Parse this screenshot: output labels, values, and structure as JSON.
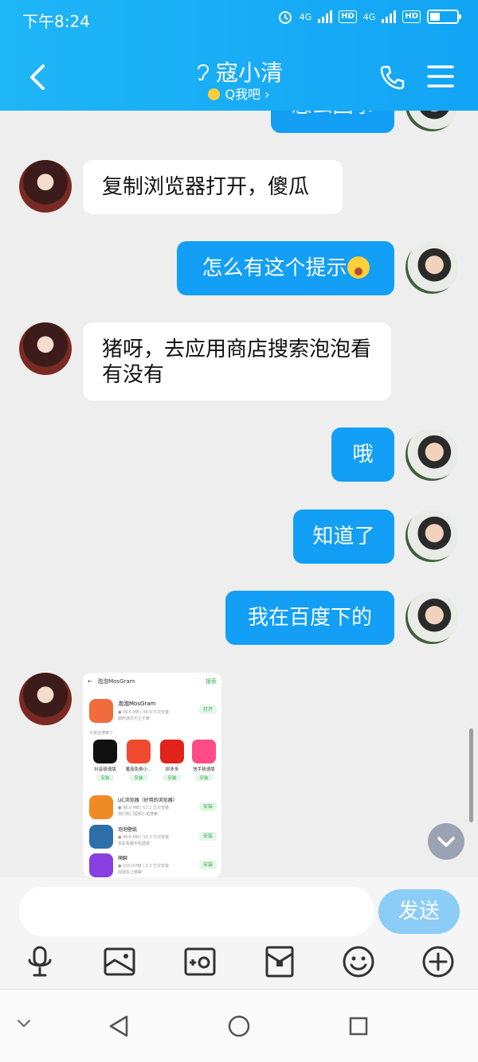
{
  "status_bar": {
    "time": "下午8:24",
    "net1": "4G",
    "hd1": "HD",
    "net2": "4G",
    "hd2": "HD"
  },
  "header": {
    "title": "寇小清",
    "subtitle": "Q我吧 ›"
  },
  "messages": [
    {
      "side": "right",
      "text": "怎么回事"
    },
    {
      "side": "left",
      "text": "复制浏览器打开，傻瓜"
    },
    {
      "side": "right",
      "text": "怎么有这个提示"
    },
    {
      "side": "left",
      "text": "猪呀，去应用商店搜索泡泡看有没有"
    },
    {
      "side": "right",
      "text": "哦"
    },
    {
      "side": "right",
      "text": "知道了"
    },
    {
      "side": "right",
      "text": "我在百度下的"
    }
  ],
  "shared_screenshot": {
    "search_query": "泡泡MosGram",
    "search_button": "搜索",
    "top_app": {
      "name": "泡泡MosGram",
      "meta": "● 99.6 MB | 36.9 万次安装",
      "desc": "即时通讯不止于聊",
      "action": "打开"
    },
    "section_title": "大家还搜索了",
    "grid_apps": [
      {
        "name": "抖音极速版",
        "action": "安装",
        "color": "#111111"
      },
      {
        "name": "番茄免费小...",
        "action": "安装",
        "color": "#ef4a2d"
      },
      {
        "name": "拼多多",
        "action": "安装",
        "color": "#e2231a"
      },
      {
        "name": "快手极速版",
        "action": "安装",
        "color": "#ff4b88"
      }
    ],
    "list_apps": [
      {
        "name": "UC浏览器（好用的浏览器）",
        "meta": "● 98.0 MB | 63.2 亿次安装",
        "desc": "他们热门视频小说搜索",
        "action": "安装",
        "color": "#f08a24"
      },
      {
        "name": "泡泡壁纸",
        "meta": "● 99.6 MB | 33.3 万次安装",
        "desc": "多彩有趣手机壁纸",
        "action": "安装",
        "color": "#2d6fa8"
      },
      {
        "name": "萌聊",
        "meta": "● 100.0 MB | 2.3 亿次安装",
        "desc": "找朋友上萌聊",
        "action": "安装",
        "color": "#8a3fe0"
      }
    ]
  },
  "input": {
    "placeholder": "",
    "send_label": "发送"
  },
  "colors": {
    "header": "#12a4f5",
    "bubble_right": "#129ff5",
    "send_disabled": "#8ccdf7"
  }
}
